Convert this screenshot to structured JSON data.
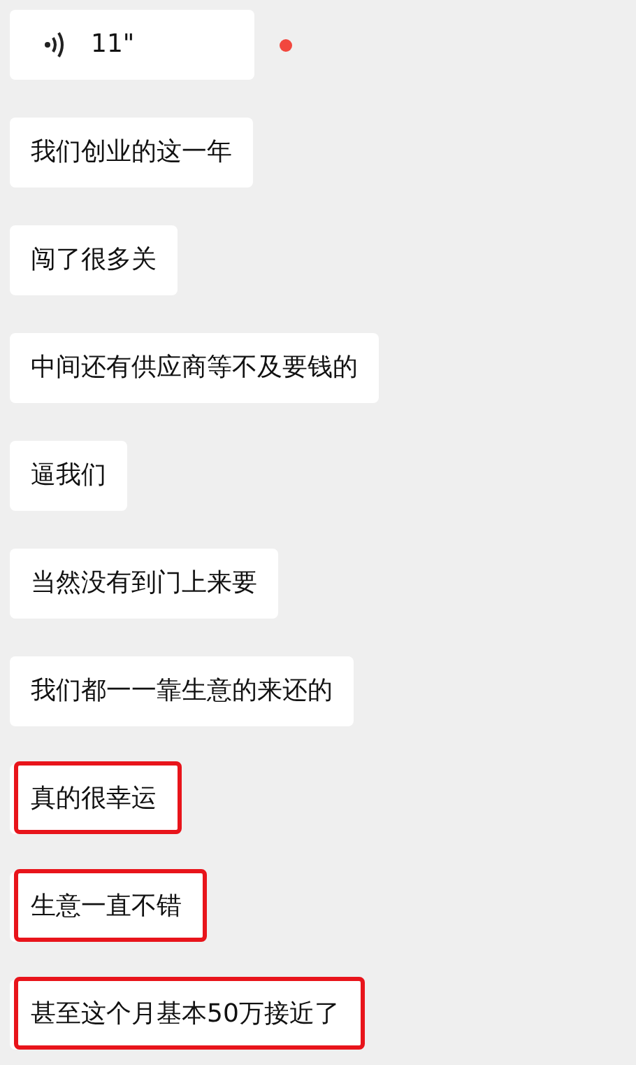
{
  "messages": [
    {
      "kind": "voice",
      "duration": "11\"",
      "unread": true
    },
    {
      "kind": "text",
      "text": "我们创业的这一年",
      "highlighted": false
    },
    {
      "kind": "text",
      "text": "闯了很多关",
      "highlighted": false
    },
    {
      "kind": "text",
      "text": "中间还有供应商等不及要钱的",
      "highlighted": false
    },
    {
      "kind": "text",
      "text": "逼我们",
      "highlighted": false
    },
    {
      "kind": "text",
      "text": "当然没有到门上来要",
      "highlighted": false
    },
    {
      "kind": "text",
      "text": "我们都一一靠生意的来还的",
      "highlighted": false
    },
    {
      "kind": "text",
      "text": "真的很幸运",
      "highlighted": true
    },
    {
      "kind": "text",
      "text": "生意一直不错",
      "highlighted": true
    },
    {
      "kind": "text",
      "text": "甚至这个月基本50万接近了",
      "highlighted": true
    }
  ]
}
